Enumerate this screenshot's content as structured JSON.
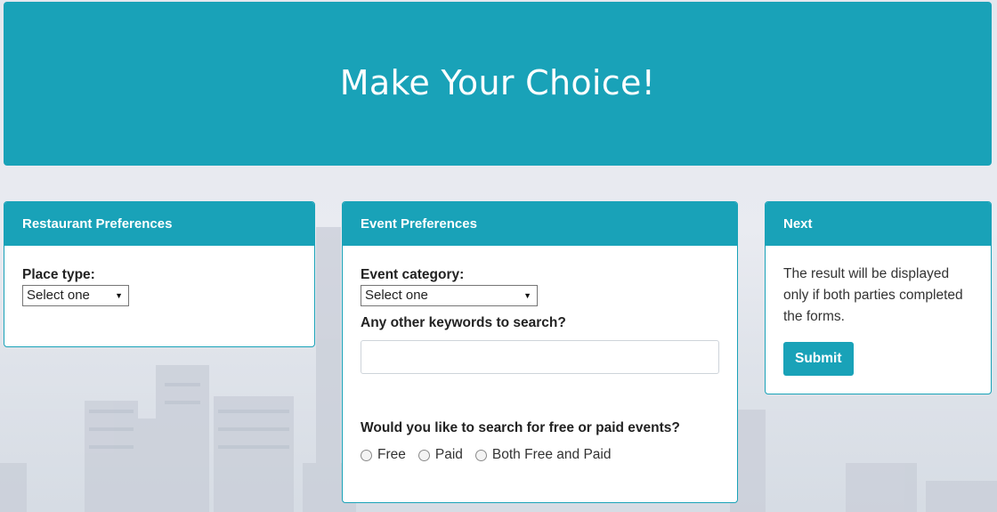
{
  "header": {
    "title": "Make Your Choice!"
  },
  "restaurant": {
    "title": "Restaurant Preferences",
    "place_type_label": "Place type:",
    "place_type_value": "Select one"
  },
  "event": {
    "title": "Event Preferences",
    "category_label": "Event category:",
    "category_value": "Select one",
    "keywords_label": "Any other keywords to search?",
    "keywords_value": "",
    "free_paid_label": "Would you like to search for free or paid events?",
    "options": [
      "Free",
      "Paid",
      "Both Free and Paid"
    ]
  },
  "next": {
    "title": "Next",
    "note": "The result will be displayed only if both parties completed the forms.",
    "submit_label": "Submit"
  },
  "colors": {
    "accent": "#19a2b8"
  },
  "icons": {
    "select_arrow": "dropdown-arrow-icon",
    "radio": "radio-unchecked-icon"
  }
}
